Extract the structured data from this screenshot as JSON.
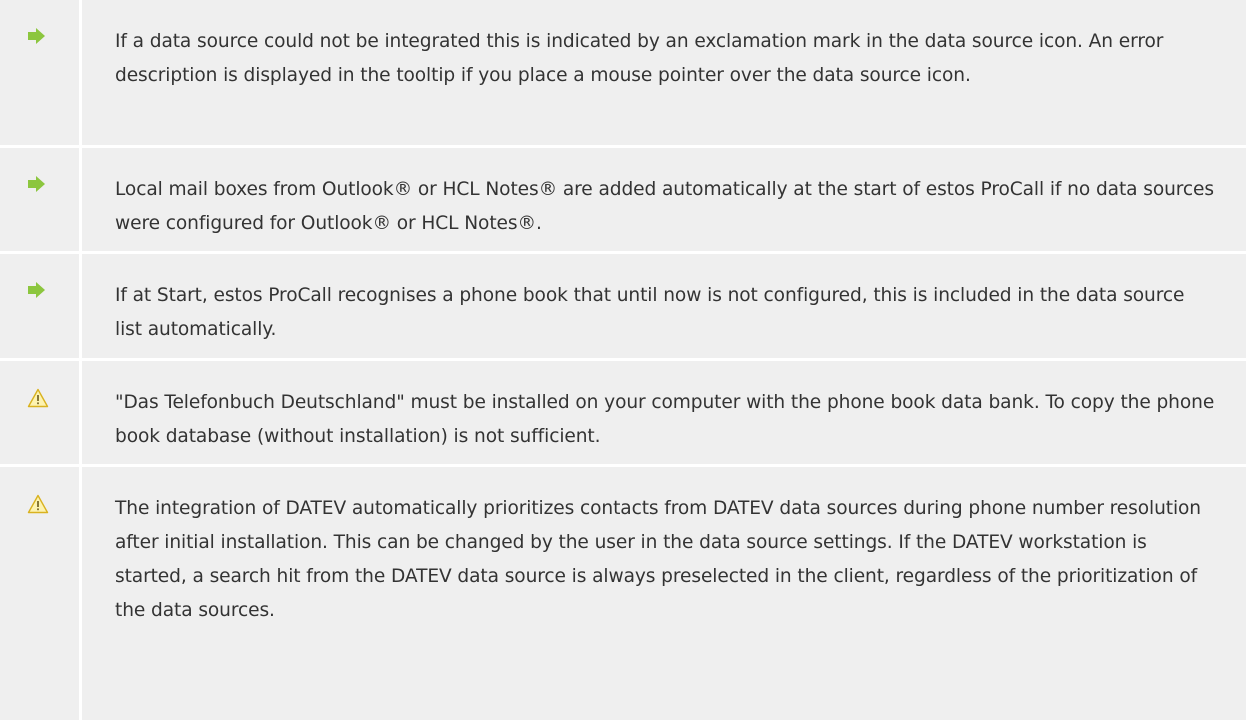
{
  "notes": [
    {
      "type": "info",
      "icon": "arrow-right-icon",
      "text": "If a data source could not be integrated this is indicated by an exclamation mark in the data source icon. An error description is displayed in the tooltip if you place a mouse pointer over the data source icon."
    },
    {
      "type": "info",
      "icon": "arrow-right-icon",
      "text": "Local mail boxes from Outlook® or HCL Notes® are added automatically at the start of estos ProCall if no data sources were configured for Outlook® or HCL Notes®."
    },
    {
      "type": "info",
      "icon": "arrow-right-icon",
      "text": "If at Start, estos ProCall recognises a phone book that until now is not configured, this is included in the data source list automatically."
    },
    {
      "type": "warning",
      "icon": "warning-triangle-icon",
      "text": "\"Das Telefonbuch Deutschland\" must be installed on your computer with the phone book data bank. To copy the phone book database (without installation) is not sufficient."
    },
    {
      "type": "warning",
      "icon": "warning-triangle-icon",
      "text": "The integration of DATEV automatically prioritizes contacts from DATEV data sources during phone number resolution after initial installation. This can be changed by the user in the data source settings. If the DATEV workstation is started, a search hit from the DATEV data source is always preselected in the client, regardless of the prioritization of the data sources."
    }
  ],
  "colors": {
    "row_background": "#efefef",
    "separator": "#ffffff",
    "text": "#333333",
    "arrow_icon": "#8cc63e",
    "warning_icon_fill": "#fdf3b0",
    "warning_icon_stroke": "#d9b21f"
  }
}
